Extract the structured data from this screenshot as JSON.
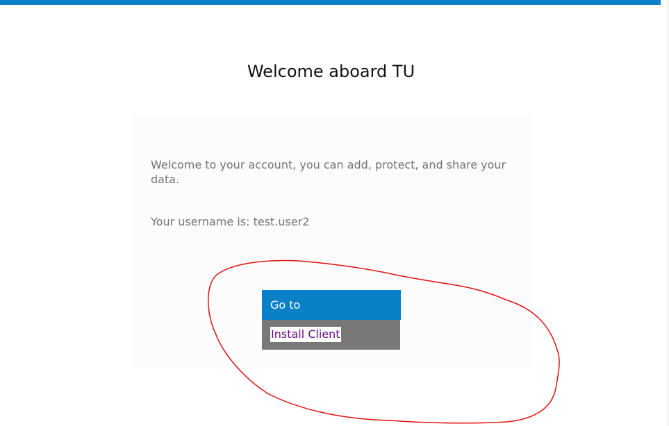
{
  "header": {
    "title": "Welcome aboard TU"
  },
  "card": {
    "welcome_text": "Welcome to your account, you can add, protect, and share your data.",
    "username_line": "Your username is: test.user2"
  },
  "actions": {
    "goto_label": "Go to",
    "install_label": "Install Client"
  },
  "colors": {
    "accent_blue": "#0a80c8",
    "install_background": "#787878",
    "link_purple": "#6a0a8a",
    "annotation_red": "#e01010"
  }
}
